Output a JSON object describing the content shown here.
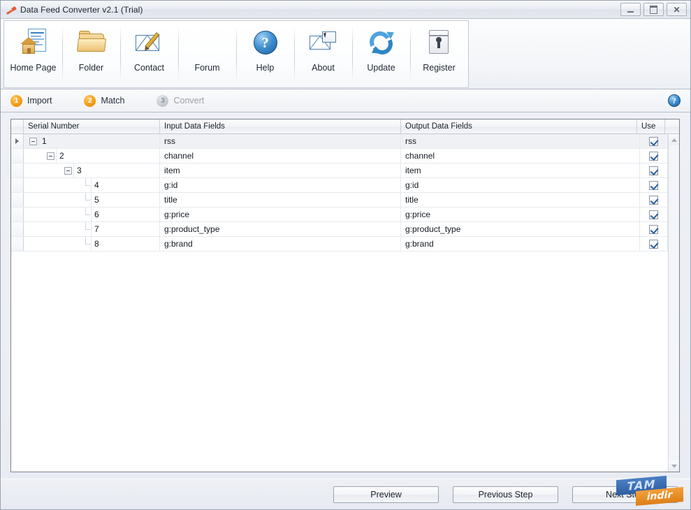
{
  "window": {
    "title": "Data Feed Converter v2.1 (Trial)",
    "icon": "app-wrench-icon",
    "controls": {
      "minimize": "–",
      "maximize": "□",
      "close": "✕"
    }
  },
  "toolbar": {
    "buttons": [
      {
        "label": "Home Page",
        "icon": "home-page-icon"
      },
      {
        "label": "Folder",
        "icon": "folder-icon"
      },
      {
        "label": "Contact",
        "icon": "contact-envelope-pencil-icon"
      },
      {
        "label": "Forum",
        "icon": "forum-people-icon"
      },
      {
        "label": "Help",
        "icon": "help-question-icon"
      },
      {
        "label": "About",
        "icon": "about-envelope-card-icon"
      },
      {
        "label": "Update",
        "icon": "update-refresh-icon"
      },
      {
        "label": "Register",
        "icon": "register-lock-icon"
      }
    ]
  },
  "steps": {
    "items": [
      {
        "number": "1",
        "label": "Import",
        "state": "active"
      },
      {
        "number": "2",
        "label": "Match",
        "state": "active"
      },
      {
        "number": "3",
        "label": "Convert",
        "state": "inactive"
      }
    ],
    "help_glyph": "?",
    "active_color": "#f09406",
    "inactive_color": "#c2c7ce"
  },
  "grid": {
    "columns": [
      "Serial Number",
      "Input Data Fields",
      "Output Data Fields",
      "Use"
    ],
    "rows": [
      {
        "serial": "1",
        "input": "rss",
        "output": "rss",
        "use": true,
        "depth": 0,
        "node": "expander",
        "selected": true
      },
      {
        "serial": "2",
        "input": "channel",
        "output": "channel",
        "use": true,
        "depth": 1,
        "node": "expander",
        "selected": false
      },
      {
        "serial": "3",
        "input": "item",
        "output": "item",
        "use": true,
        "depth": 2,
        "node": "expander",
        "selected": false
      },
      {
        "serial": "4",
        "input": "g:id",
        "output": "g:id",
        "use": true,
        "depth": 3,
        "node": "leaf",
        "selected": false
      },
      {
        "serial": "5",
        "input": "title",
        "output": "title",
        "use": true,
        "depth": 3,
        "node": "leaf",
        "selected": false
      },
      {
        "serial": "6",
        "input": "g:price",
        "output": "g:price",
        "use": true,
        "depth": 3,
        "node": "leaf",
        "selected": false
      },
      {
        "serial": "7",
        "input": "g:product_type",
        "output": "g:product_type",
        "use": true,
        "depth": 3,
        "node": "leaf",
        "selected": false
      },
      {
        "serial": "8",
        "input": "g:brand",
        "output": "g:brand",
        "use": true,
        "depth": 3,
        "node": "leaf",
        "selected": false
      }
    ]
  },
  "footer": {
    "buttons": [
      {
        "label": "Preview"
      },
      {
        "label": "Previous Step"
      },
      {
        "label": "Next Step"
      }
    ]
  },
  "watermark": {
    "top": "TAM",
    "bottom": "indir"
  }
}
